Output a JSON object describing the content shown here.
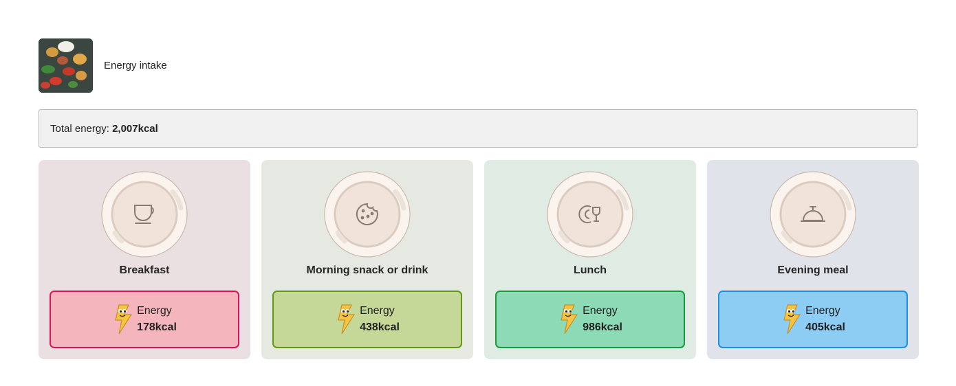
{
  "header": {
    "title": "Energy intake",
    "image": "food-photo"
  },
  "total": {
    "label": "Total energy:",
    "value": "2,007kcal"
  },
  "meals": [
    {
      "name": "Breakfast",
      "icon": "cup-icon",
      "energy_label": "Energy",
      "energy_value": "178kcal",
      "card_bg": "#ebe0e1",
      "box_bg": "#f5b5bc",
      "box_border": "#e0115a"
    },
    {
      "name": "Morning snack or drink",
      "icon": "cookie-icon",
      "energy_label": "Energy",
      "energy_value": "438kcal",
      "card_bg": "#e6e9e1",
      "box_bg": "#c6d898",
      "box_border": "#5f9a12"
    },
    {
      "name": "Lunch",
      "icon": "cutlery-glass-icon",
      "energy_label": "Energy",
      "energy_value": "986kcal",
      "card_bg": "#e0ebe4",
      "box_bg": "#8ddbb6",
      "box_border": "#169d3a"
    },
    {
      "name": "Evening meal",
      "icon": "cloche-icon",
      "energy_label": "Energy",
      "energy_value": "405kcal",
      "card_bg": "#e0e3ea",
      "box_bg": "#8ecdf3",
      "box_border": "#1d8fe3"
    }
  ]
}
